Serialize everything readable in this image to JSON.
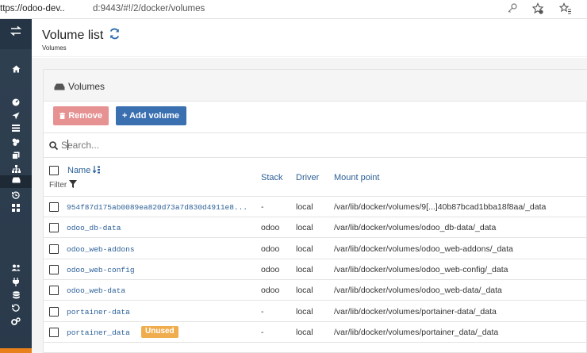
{
  "browser": {
    "url_left": "ttps://odoo-dev..",
    "url_right": "d:9443/#!/2/docker/volumes"
  },
  "header": {
    "title": "Volume list",
    "breadcrumb": "Volumes"
  },
  "widget": {
    "title": "Volumes",
    "remove_label": "Remove",
    "add_label": "+ Add volume"
  },
  "search": {
    "placeholder": "Search..."
  },
  "table": {
    "columns": {
      "name": "Name",
      "filter": "Filter",
      "stack": "Stack",
      "driver": "Driver",
      "mount": "Mount point"
    },
    "rows": [
      {
        "name": "954f87d175ab0089ea820d73a7d830d4911e8...",
        "stack": "-",
        "driver": "local",
        "mount": "/var/lib/docker/volumes/9[...]40b87bcad1bba18f8aa/_data",
        "badge": ""
      },
      {
        "name": "odoo_db-data",
        "stack": "odoo",
        "driver": "local",
        "mount": "/var/lib/docker/volumes/odoo_db-data/_data",
        "badge": ""
      },
      {
        "name": "odoo_web-addons",
        "stack": "odoo",
        "driver": "local",
        "mount": "/var/lib/docker/volumes/odoo_web-addons/_data",
        "badge": ""
      },
      {
        "name": "odoo_web-config",
        "stack": "odoo",
        "driver": "local",
        "mount": "/var/lib/docker/volumes/odoo_web-config/_data",
        "badge": ""
      },
      {
        "name": "odoo_web-data",
        "stack": "odoo",
        "driver": "local",
        "mount": "/var/lib/docker/volumes/odoo_web-data/_data",
        "badge": ""
      },
      {
        "name": "portainer-data",
        "stack": "-",
        "driver": "local",
        "mount": "/var/lib/docker/volumes/portainer-data/_data",
        "badge": ""
      },
      {
        "name": "portainer_data",
        "stack": "-",
        "driver": "local",
        "mount": "/var/lib/docker/volumes/portainer_data/_data",
        "badge": "Unused"
      }
    ]
  },
  "colors": {
    "sidebar": "#2d3e50",
    "link": "#2b5f97",
    "remove": "#e69192",
    "add": "#3a6fb0",
    "badge": "#f0ad4e"
  }
}
